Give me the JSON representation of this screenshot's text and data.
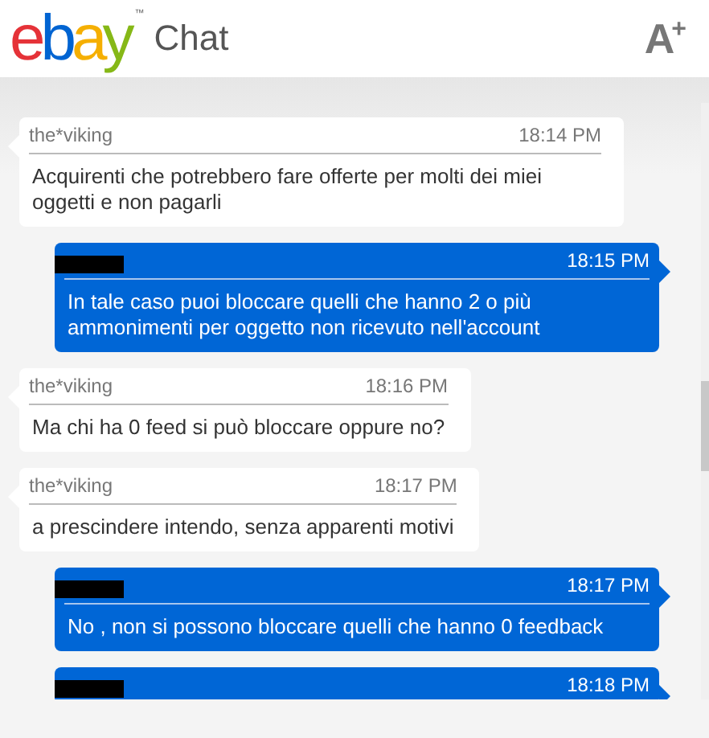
{
  "header": {
    "logo": "ebay",
    "trademark": "™",
    "title": "Chat",
    "font_size_button": "A$^{+}$"
  },
  "messages": [
    {
      "kind": "agent",
      "sender": "the*viking",
      "time": "18:14 PM",
      "text": "Acquirenti che potrebbero fare offerte per molti dei miei oggetti e non pagarli"
    },
    {
      "kind": "user",
      "time": "18:15 PM",
      "text": "In tale caso puoi bloccare quelli che hanno 2 o più ammonimenti per oggetto non ricevuto nell'account"
    },
    {
      "kind": "agent",
      "sender": "the*viking",
      "time": "18:16 PM",
      "text": "Ma chi ha 0 feed si può bloccare oppure no?"
    },
    {
      "kind": "agent",
      "sender": "the*viking",
      "time": "18:17 PM",
      "text": "a prescindere intendo, senza apparenti motivi"
    },
    {
      "kind": "user",
      "time": "18:17 PM",
      "text": "No , non si possono bloccare quelli che hanno 0 feedback"
    },
    {
      "kind": "user",
      "time": "18:18 PM"
    }
  ]
}
